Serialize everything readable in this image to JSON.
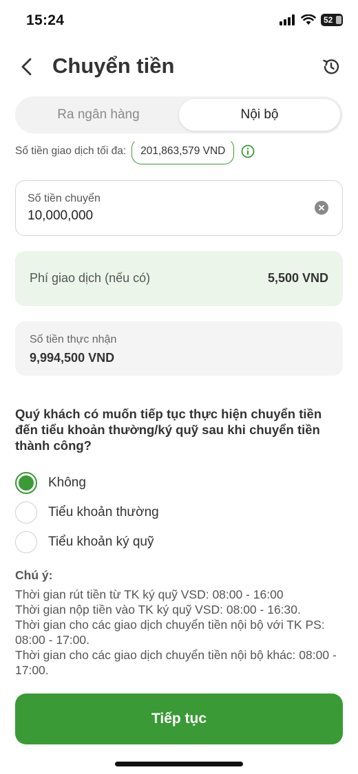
{
  "status_bar": {
    "time": "15:24",
    "battery": "52",
    "icons": [
      "signal-icon",
      "wifi-icon",
      "battery-icon"
    ]
  },
  "header": {
    "title": "Chuyển tiền",
    "back_icon": "chevron-left-icon",
    "history_icon": "history-icon"
  },
  "tabs": [
    {
      "label": "Ra ngân hàng",
      "active": false
    },
    {
      "label": "Nội bộ",
      "active": true
    }
  ],
  "limit": {
    "label": "Số tiền giao dịch tối đa:",
    "value": "201,863,579 VND"
  },
  "amount": {
    "label": "Số tiền chuyển",
    "value": "10,000,000"
  },
  "fee": {
    "label": "Phí giao dịch (nếu có)",
    "value": "5,500 VND"
  },
  "received": {
    "label": "Số tiền thực nhận",
    "value": "9,994,500 VND"
  },
  "question": "Quý khách có muốn tiếp tục thực hiện chuyển tiền đến tiểu khoản thường/ký quỹ sau khi chuyển tiền thành công?",
  "options": [
    {
      "label": "Không",
      "selected": true
    },
    {
      "label": "Tiểu khoản thường",
      "selected": false
    },
    {
      "label": "Tiểu khoản ký quỹ",
      "selected": false
    }
  ],
  "notes": {
    "title": "Chú ý:",
    "lines": [
      "Thời gian rút tiền từ TK ký quỹ VSD: 08:00 - 16:00",
      "Thời gian nộp tiền vào TK ký quỹ VSD: 08:00 - 16:30.",
      "Thời gian cho các giao dịch chuyển tiền nội bộ với TK PS: 08:00 - 17:00.",
      "Thời gian cho các giao dịch chuyển tiền nội bộ khác: 08:00 - 17:00."
    ]
  },
  "continue_label": "Tiếp tục",
  "colors": {
    "accent": "#3a9a35",
    "fee_background": "#ebf5ea"
  }
}
